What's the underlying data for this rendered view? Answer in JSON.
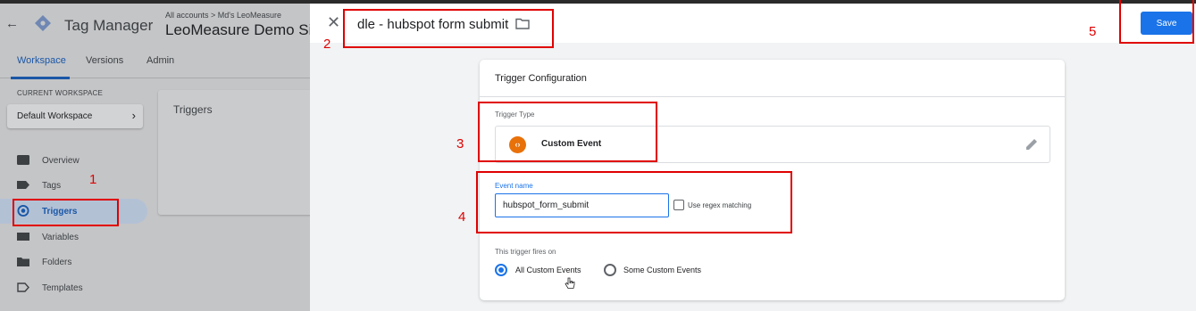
{
  "app": {
    "back_glyph": "←",
    "name": "Tag Manager",
    "accounts_crumb": "All accounts > Md's LeoMeasure",
    "container_name": "LeoMeasure Demo Site",
    "tabs": [
      {
        "label": "Workspace",
        "active": true
      },
      {
        "label": "Versions",
        "active": false
      },
      {
        "label": "Admin",
        "active": false
      }
    ],
    "current_workspace_label": "CURRENT WORKSPACE",
    "workspace_name": "Default Workspace",
    "nav": [
      {
        "label": "Overview",
        "icon": "overview-icon",
        "active": false
      },
      {
        "label": "Tags",
        "icon": "tag-icon",
        "active": false
      },
      {
        "label": "Triggers",
        "icon": "trigger-icon",
        "active": true
      },
      {
        "label": "Variables",
        "icon": "variables-icon",
        "active": false
      },
      {
        "label": "Folders",
        "icon": "folder-icon",
        "active": false
      },
      {
        "label": "Templates",
        "icon": "templates-icon",
        "active": false
      }
    ],
    "triggers_panel_title": "Triggers"
  },
  "editor": {
    "close_glyph": "✕",
    "trigger_name": "dle - hubspot form submit",
    "save_label": "Save",
    "card_title": "Trigger Configuration",
    "trigger_type_label": "Trigger Type",
    "trigger_type_icon_glyph": "‹›",
    "trigger_type_name": "Custom Event",
    "event_name_label": "Event name",
    "event_name_value": "hubspot_form_submit",
    "regex_label": "Use regex matching",
    "fires_on_label": "This trigger fires on",
    "fire_options": [
      {
        "label": "All Custom Events",
        "checked": true
      },
      {
        "label": "Some Custom Events",
        "checked": false
      }
    ]
  },
  "annotations": [
    "1",
    "2",
    "3",
    "4",
    "5"
  ],
  "colors": {
    "accent": "#1a73e8",
    "annotation": "#e00000",
    "custom_event_icon": "#e8710a"
  }
}
